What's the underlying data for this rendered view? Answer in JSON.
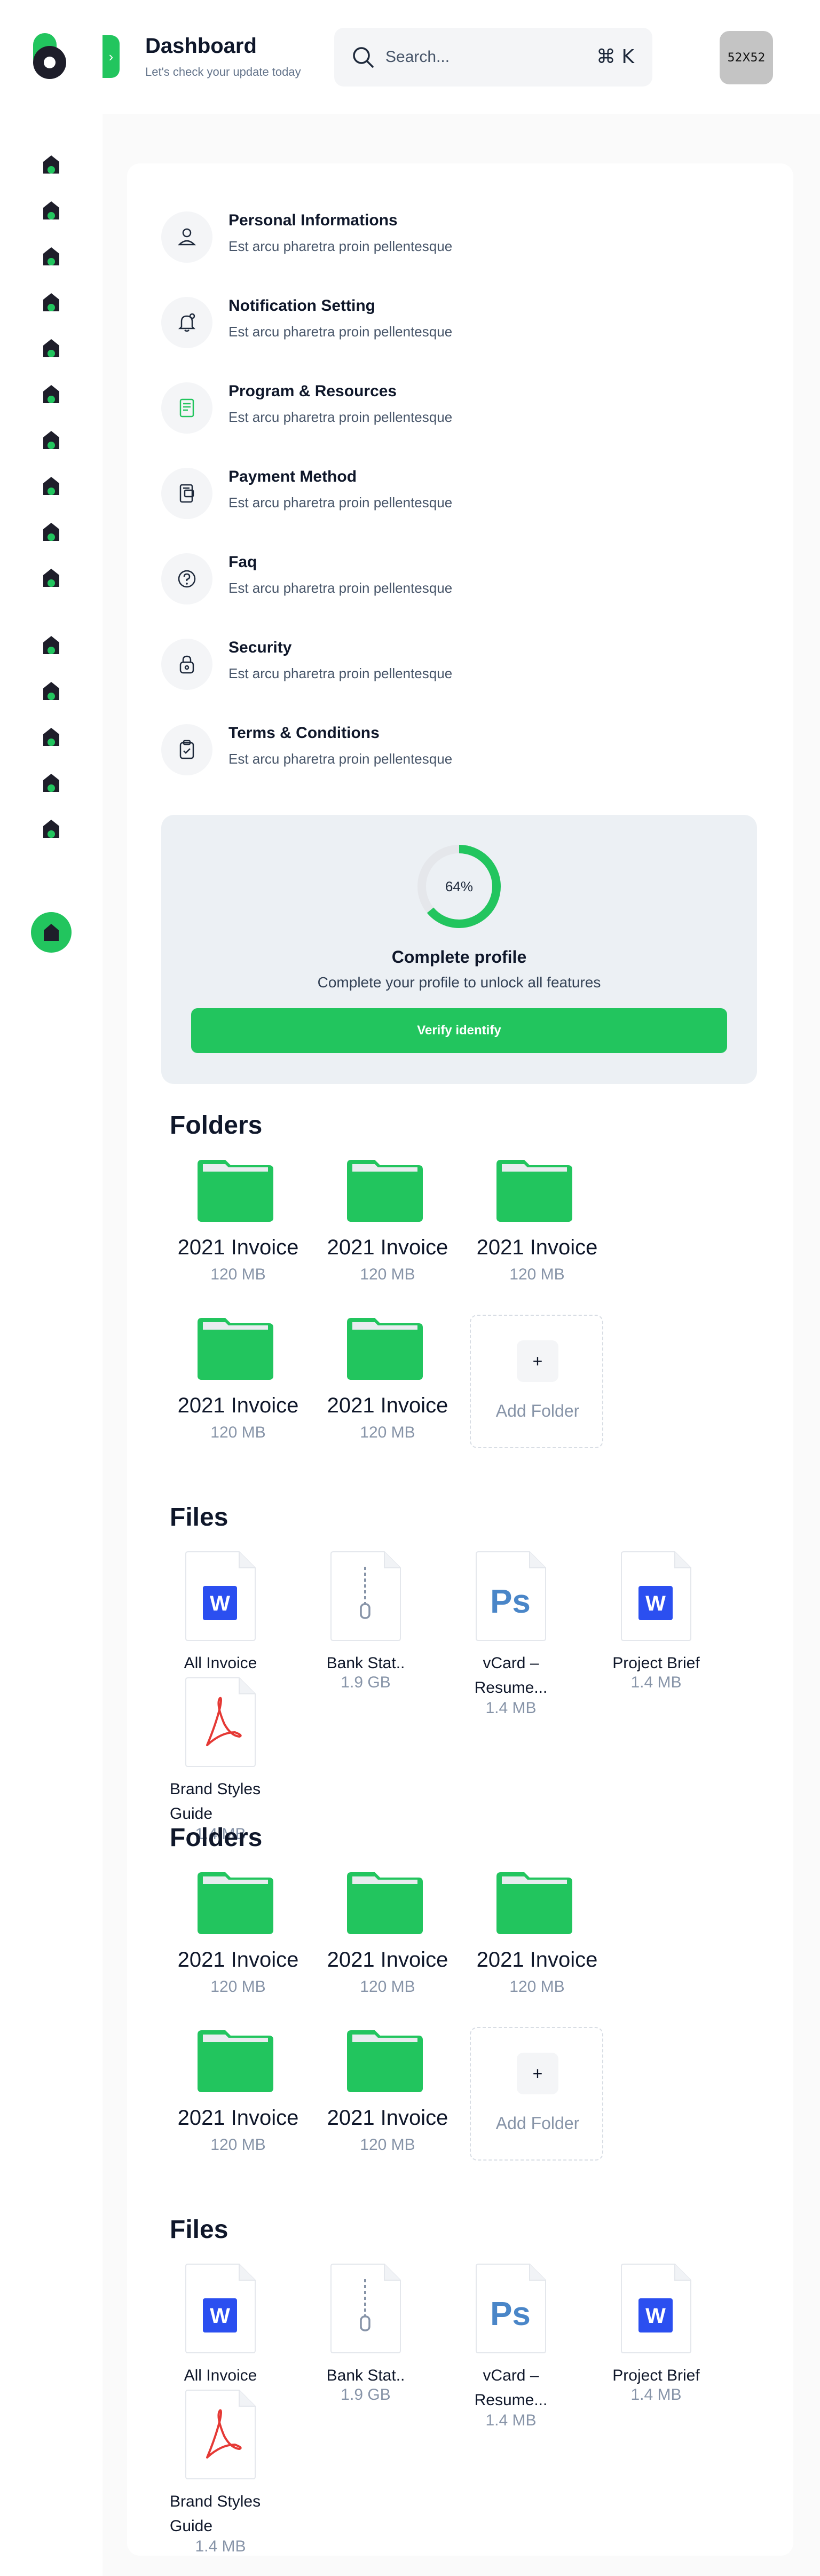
{
  "header": {
    "title": "Dashboard",
    "subtitle": "Let's check your update today",
    "search_placeholder": "Search...",
    "shortcut": "⌘ K",
    "avatar_label": "52X52"
  },
  "sidebar": {
    "nav_icon_count": 16,
    "active_icon": "home-icon"
  },
  "settings_menu": [
    {
      "icon": "user-icon",
      "title": "Personal Informations",
      "subtitle": "Est arcu pharetra proin pellentesque"
    },
    {
      "icon": "bell-icon",
      "title": "Notification Setting",
      "subtitle": "Est arcu pharetra proin pellentesque"
    },
    {
      "icon": "book-icon",
      "title": "Program & Resources",
      "subtitle": "Est arcu pharetra proin pellentesque"
    },
    {
      "icon": "wallet-icon",
      "title": "Payment Method",
      "subtitle": "Est arcu pharetra proin pellentesque"
    },
    {
      "icon": "question-icon",
      "title": "Faq",
      "subtitle": "Est arcu pharetra proin pellentesque"
    },
    {
      "icon": "lock-icon",
      "title": "Security",
      "subtitle": "Est arcu pharetra proin pellentesque"
    },
    {
      "icon": "clipboard-check-icon",
      "title": "Terms & Conditions",
      "subtitle": "Est arcu pharetra proin pellentesque"
    }
  ],
  "profile": {
    "progress_label": "64%",
    "progress_value": 0.64,
    "title": "Complete profile",
    "subtitle": "Complete your profile to unlock all features",
    "button_label": "Verify identify"
  },
  "sections": [
    {
      "folders_title": "Folders",
      "folders": [
        {
          "name": "2021 Invoice",
          "size": "120 MB"
        },
        {
          "name": "2021 Invoice",
          "size": "120 MB"
        },
        {
          "name": "2021 Invoice",
          "size": "120 MB"
        },
        {
          "name": "2021 Invoice",
          "size": "120 MB"
        },
        {
          "name": "2021 Invoice",
          "size": "120 MB"
        }
      ],
      "add_folder_label": "Add Folder",
      "files_title": "Files",
      "files": [
        {
          "type": "word",
          "name": "All Invoice",
          "size": ""
        },
        {
          "type": "zip",
          "name": "Bank Stat..",
          "size": "1.9 GB"
        },
        {
          "type": "photoshop",
          "name": "vCard – Resume...",
          "size": "1.4 MB"
        },
        {
          "type": "word",
          "name": "Project Brief",
          "size": "1.4 MB"
        },
        {
          "type": "pdf",
          "name": "Brand Styles Guide",
          "size": "1.4 MB"
        }
      ]
    },
    {
      "folders_title": "Folders",
      "folders": [
        {
          "name": "2021 Invoice",
          "size": "120 MB"
        },
        {
          "name": "2021 Invoice",
          "size": "120 MB"
        },
        {
          "name": "2021 Invoice",
          "size": "120 MB"
        },
        {
          "name": "2021 Invoice",
          "size": "120 MB"
        },
        {
          "name": "2021 Invoice",
          "size": "120 MB"
        }
      ],
      "add_folder_label": "Add Folder",
      "files_title": "Files",
      "files": [
        {
          "type": "word",
          "name": "All Invoice",
          "size": ""
        },
        {
          "type": "zip",
          "name": "Bank Stat..",
          "size": "1.9 GB"
        },
        {
          "type": "photoshop",
          "name": "vCard – Resume...",
          "size": "1.4 MB"
        },
        {
          "type": "word",
          "name": "Project Brief",
          "size": "1.4 MB"
        },
        {
          "type": "pdf",
          "name": "Brand Styles Guide",
          "size": "1.4 MB"
        }
      ]
    }
  ],
  "colors": {
    "accent": "#22c55e",
    "dark": "#1e1e2a",
    "muted": "#8794a8",
    "word_blue": "#2b4ff0",
    "ps_blue": "#4a86c8",
    "pdf_red": "#e53935"
  }
}
